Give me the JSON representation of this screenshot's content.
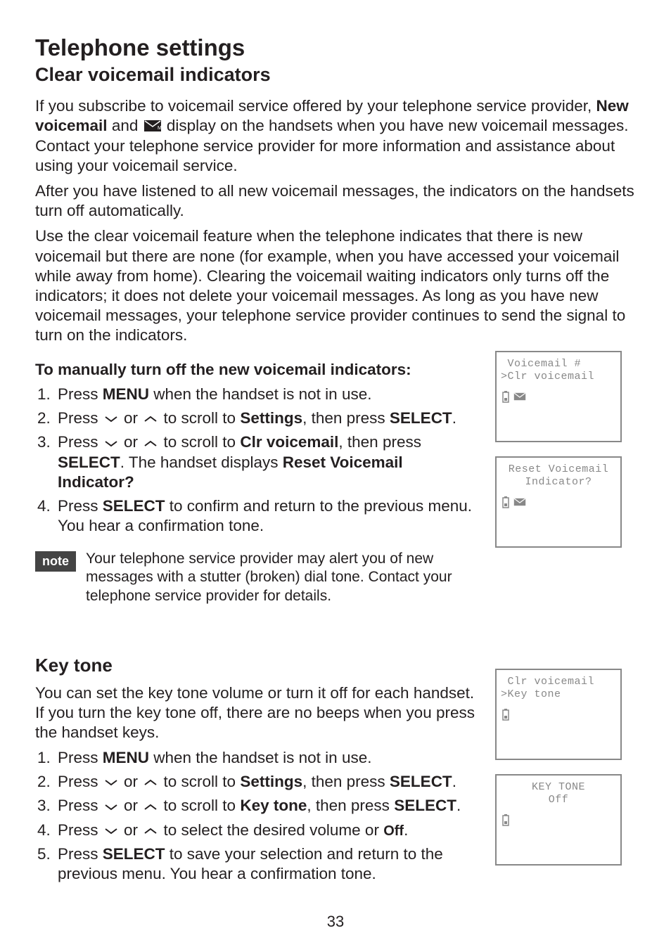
{
  "page_number": "33",
  "heading": "Telephone settings",
  "section1": {
    "title": "Clear voicemail indicators",
    "para1_a": "If you subscribe to voicemail service offered by your telephone service provider, ",
    "para1_bold": "New voicemail",
    "para1_b": " and ",
    "para1_c": " display on the handsets when you have new voicemail messages. Contact your telephone service provider for more information and assistance about using your voicemail service.",
    "para2": "After you have listened to all new voicemail messages, the indicators on the handsets turn off automatically.",
    "para3": "Use the clear voicemail feature when the telephone indicates that there is new voicemail but there are none (for example, when you have accessed your voicemail while away from home). Clearing the voicemail waiting indicators only turns off the indicators; it does not delete your voicemail messages. As long as you have new voicemail messages, your telephone service provider continues to send the signal to turn on the indicators.",
    "proc_head": "To manually turn off the new voicemail indicators:",
    "steps": [
      {
        "pre": "Press ",
        "key": "MENU",
        "post": " when the handset is not in use."
      },
      {
        "pre": "Press ",
        "mid": " or ",
        "mid2": " to scroll to ",
        "target": "Settings",
        "tail1": ", then press ",
        "action": "SELECT",
        "tail2": "."
      },
      {
        "pre": "Press ",
        "mid": " or ",
        "mid2": " to scroll to ",
        "target": "Clr voicemail",
        "tail1": ", then press ",
        "action": "SELECT",
        "tail2": ". The handset displays ",
        "extra_bold": "Reset Voicemail Indicator?"
      },
      {
        "pre": "Press ",
        "key": "SELECT",
        "post": " to confirm and return to the previous menu. You hear a confirmation tone."
      }
    ],
    "note_label": "note",
    "note_text": "Your telephone service provider may alert you of new messages with a stutter (broken) dial tone. Contact your telephone service provider for details.",
    "lcd1": {
      "line1": " Voicemail #",
      "line2": ">Clr voicemail"
    },
    "lcd2": {
      "line1": "Reset Voicemail",
      "line2": "Indicator?"
    }
  },
  "section2": {
    "title": "Key tone",
    "para1": "You can set the key tone volume or turn it off for each handset. If you turn the key tone off, there are no beeps when you press the handset keys.",
    "steps": [
      {
        "pre": "Press ",
        "key": "MENU",
        "post": " when the handset is not in use."
      },
      {
        "pre": "Press ",
        "mid": " or ",
        "mid2": " to scroll to ",
        "target": "Settings",
        "tail1": ", then press ",
        "action": "SELECT",
        "tail2": "."
      },
      {
        "pre": "Press ",
        "mid": " or ",
        "mid2": " to scroll to ",
        "target": "Key tone",
        "tail1": ", then press ",
        "action": "SELECT",
        "tail2": "."
      },
      {
        "pre": "Press ",
        "mid": " or ",
        "mid2": " to select the desired volume or ",
        "small": "Off",
        "tail2": "."
      },
      {
        "pre": "Press ",
        "key": "SELECT",
        "post": " to save your selection and return to the previous menu. You hear a confirmation tone."
      }
    ],
    "lcd1": {
      "line1": " Clr voicemail",
      "line2": ">Key tone"
    },
    "lcd2": {
      "line1": "KEY TONE",
      "line2": "Off"
    }
  }
}
